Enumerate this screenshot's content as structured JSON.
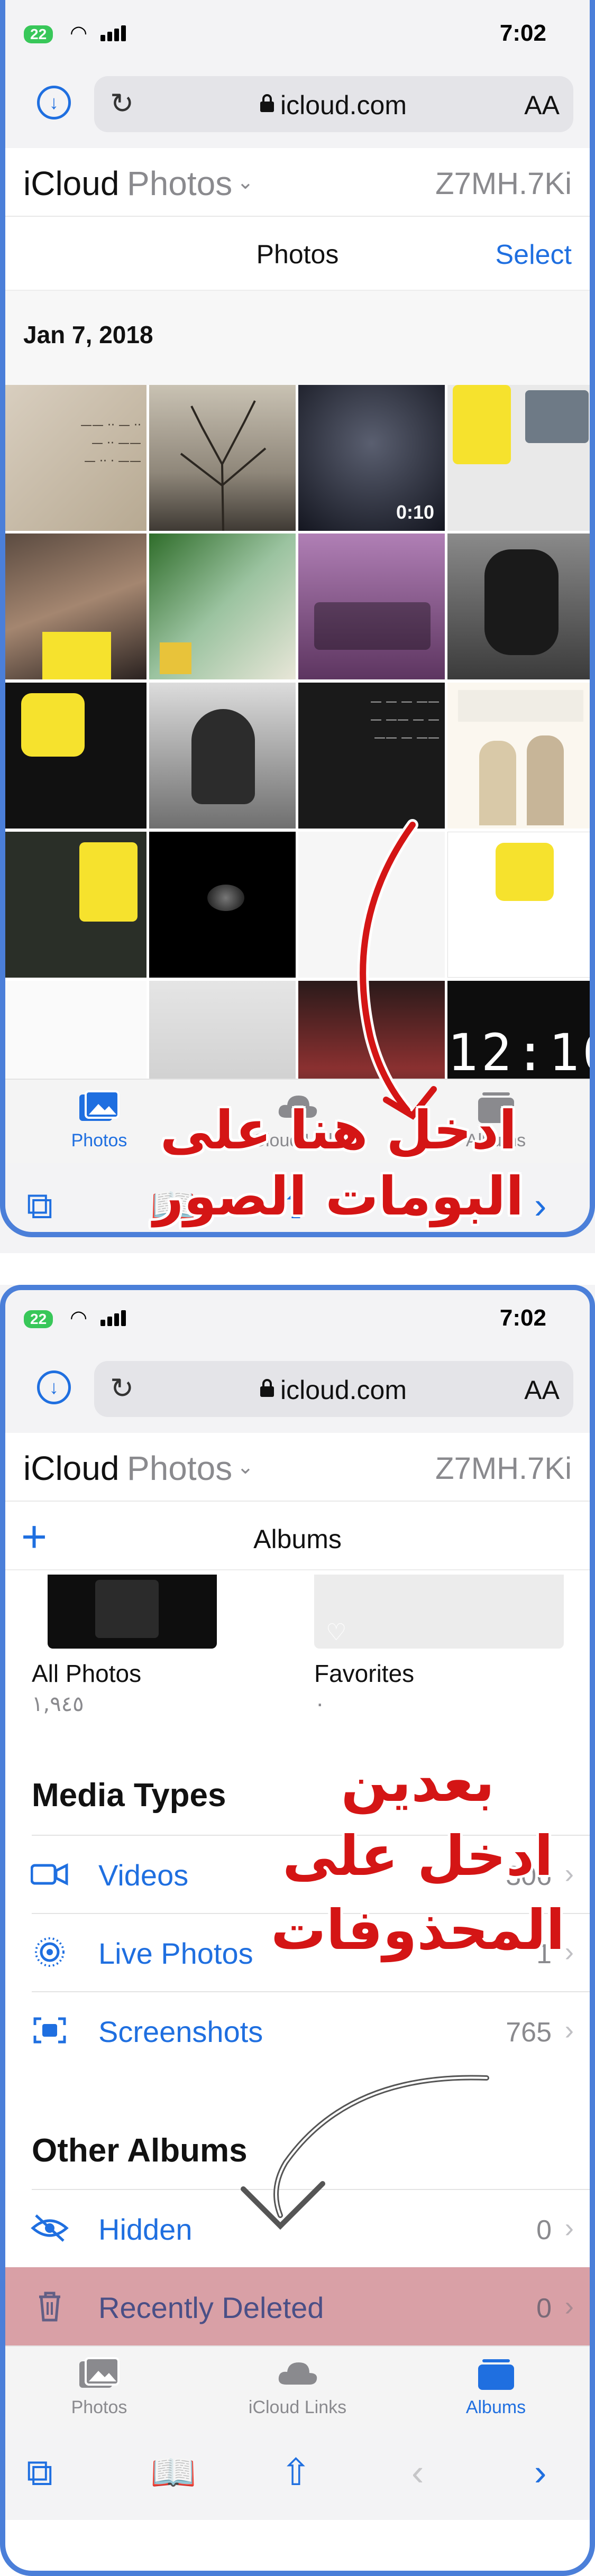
{
  "status": {
    "battery": "22",
    "time": "7:02"
  },
  "browser": {
    "url": "icloud.com",
    "text_size": "AA"
  },
  "icloud": {
    "brand": "iCloud",
    "app": "Photos",
    "account": "Z7MH.7Ki"
  },
  "screen1": {
    "title": "Photos",
    "select_label": "Select",
    "date": "Jan 7, 2018",
    "video_duration": "0:10",
    "clock_photo_text": "12:16",
    "annotation": "ادخل هنا على البومات الصور"
  },
  "screen2": {
    "title": "Albums",
    "all_photos": {
      "name": "All Photos",
      "count": "١,٩٤٥"
    },
    "favorites": {
      "name": "Favorites",
      "count": "٠"
    },
    "media_types_heading": "Media Types",
    "media_types": [
      {
        "icon": "video-icon",
        "label": "Videos",
        "count": "306"
      },
      {
        "icon": "live-photo-icon",
        "label": "Live Photos",
        "count": "1"
      },
      {
        "icon": "screenshot-icon",
        "label": "Screenshots",
        "count": "765"
      }
    ],
    "other_albums_heading": "Other Albums",
    "other_albums": [
      {
        "icon": "eye-slash-icon",
        "label": "Hidden",
        "count": "0"
      },
      {
        "icon": "trash-icon",
        "label": "Recently Deleted",
        "count": "0"
      }
    ],
    "annotation": "بعدين ادخل على المحذوفات"
  },
  "tabs": [
    {
      "label": "Photos",
      "icon": "photos-icon"
    },
    {
      "label": "iCloud Links",
      "icon": "cloud-icon"
    },
    {
      "label": "Albums",
      "icon": "albums-icon"
    }
  ],
  "colors": {
    "accent": "#1f6fe0",
    "annotation": "#d41515",
    "highlight": "#d9a0a6",
    "frame": "#4b7fd9"
  }
}
